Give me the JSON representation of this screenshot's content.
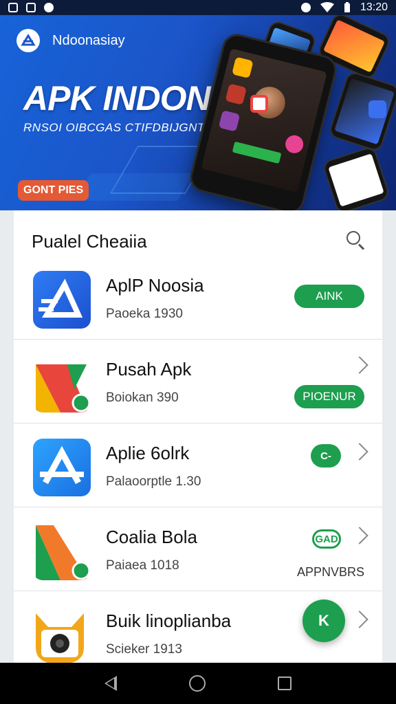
{
  "status_bar": {
    "time": "13:20",
    "icons": [
      "notification-icon",
      "sync-icon",
      "circle-icon",
      "alarm-icon",
      "wifi-icon",
      "battery-icon"
    ]
  },
  "banner": {
    "brand_name": "Ndoonasiay",
    "title": "APK INDONESIA",
    "subtitle": "RNSOI OIBCGAS CTIFDBIJGNTA.",
    "cta_label": "GONT PIES"
  },
  "list": {
    "header": "Pualel Cheaiia",
    "apps": [
      {
        "name": "AplP Noosia",
        "meta": "Paoeka 1930",
        "action": "AINK"
      },
      {
        "name": "Pusah Apk",
        "meta": "Boiokan 390",
        "action": "PIOENUR"
      },
      {
        "name": "Aplie 6olrk",
        "meta": "Palaoorptle 1.30",
        "action": "C-"
      },
      {
        "name": "Coalia Bola",
        "meta": "Paiaea 1018",
        "action": "GAD",
        "secondary": "APPNVBRS"
      },
      {
        "name": "Buik linoplianba",
        "meta": "Scieker 1913",
        "action": "K"
      }
    ]
  },
  "colors": {
    "accent_green": "#1e9e4f",
    "banner_blue": "#1763d8",
    "cta_orange": "#e35a35"
  }
}
